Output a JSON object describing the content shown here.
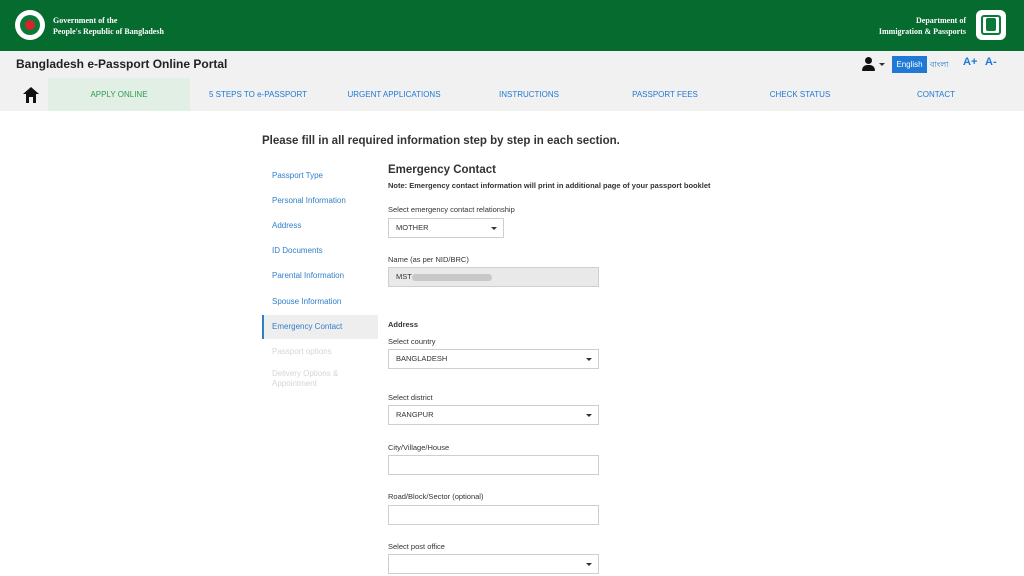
{
  "gov": {
    "left_line1": "Government of the",
    "left_line2": "People's Republic of Bangladesh",
    "right_line1": "Department of",
    "right_line2": "Immigration & Passports",
    "left_emblem_icon": "bangladesh-seal-icon",
    "right_emblem_icon": "dip-logo-icon"
  },
  "portal": {
    "title": "Bangladesh e-Passport Online Portal",
    "lang_english": "English",
    "lang_bangla": "বাংলা",
    "font_increase": "A+",
    "font_decrease": "A-",
    "user_icon": "user-icon"
  },
  "nav": {
    "home_icon": "home-icon",
    "items": [
      {
        "label": "APPLY ONLINE",
        "active": true
      },
      {
        "label": "5 STEPS TO e-PASSPORT"
      },
      {
        "label": "URGENT APPLICATIONS"
      },
      {
        "label": "INSTRUCTIONS"
      },
      {
        "label": "PASSPORT FEES"
      },
      {
        "label": "CHECK STATUS"
      },
      {
        "label": "CONTACT"
      }
    ]
  },
  "page": {
    "heading": "Please fill in all required information step by step in each section."
  },
  "sidebar": {
    "items": [
      {
        "label": "Passport Type",
        "state": "link"
      },
      {
        "label": "Personal Information",
        "state": "link"
      },
      {
        "label": "Address",
        "state": "link"
      },
      {
        "label": "ID Documents",
        "state": "link"
      },
      {
        "label": "Parental Information",
        "state": "link"
      },
      {
        "label": "Spouse Information",
        "state": "link"
      },
      {
        "label": "Emergency Contact",
        "state": "active"
      },
      {
        "label": "Passport options",
        "state": "disabled"
      },
      {
        "label": "Delivery Options & Appointment",
        "state": "disabled"
      }
    ]
  },
  "form": {
    "title": "Emergency Contact",
    "note": "Note: Emergency contact information will print in additional page of your passport booklet",
    "relationship_label": "Select emergency contact relationship",
    "relationship_value": "MOTHER",
    "name_label": "Name (as per NID/BRC)",
    "name_value": "MST",
    "address_heading": "Address",
    "country_label": "Select country",
    "country_value": "BANGLADESH",
    "district_label": "Select district",
    "district_value": "RANGPUR",
    "city_label": "City/Village/House",
    "city_value": "",
    "road_label": "Road/Block/Sector (optional)",
    "road_value": "",
    "post_office_label": "Select post office",
    "post_office_value": ""
  },
  "colors": {
    "header_green": "#066b2e",
    "link_blue": "#2079d4",
    "active_green": "#2e9b52"
  }
}
